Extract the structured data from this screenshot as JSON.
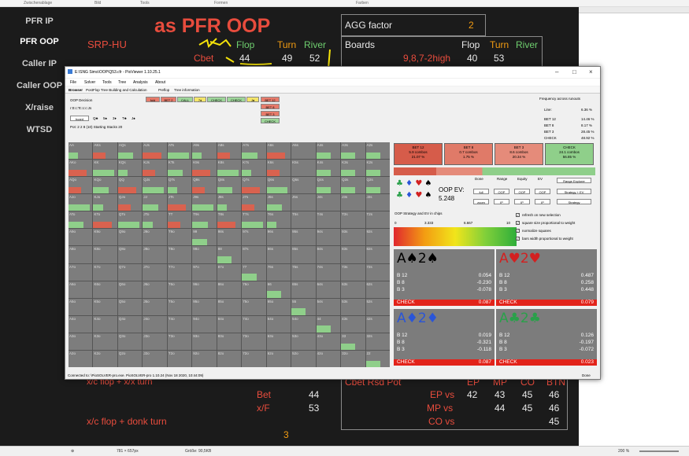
{
  "host": {
    "ribbon": [
      "Zwischenablage",
      "Bild",
      "Tools",
      "Formen",
      "Farben"
    ],
    "status": {
      "size": "781 × 657px",
      "filesize": "Größe: 90,5KB",
      "zoom": "200 %"
    }
  },
  "slide": {
    "sidebar": [
      "PFR IP",
      "PFR OOP",
      "Caller IP",
      "Caller OOP",
      "X/raise",
      "WTSD"
    ],
    "title": "as PFR OOP",
    "srp": "SRP-HU",
    "flop": "Flop",
    "turn": "Turn",
    "river": "River",
    "cbet": "Cbet",
    "cbet_vals": [
      "44",
      "49",
      "52"
    ],
    "agg_factor_label": "AGG factor",
    "agg_factor_value": "2",
    "boards_label": "Boards",
    "boards_value": "9,8,7-2high",
    "boards_vals": [
      "40",
      "53"
    ],
    "xc_label": "x/c flop + x/x turn",
    "bet_label": "Bet",
    "xf_label": "x/F",
    "bet_val": "44",
    "xf_val": "53",
    "donk_label": "x/c flop + donk turn",
    "donk_val": "3",
    "cbet_rsd": "Cbet Rsd Pot",
    "pos_headers": [
      "EP",
      "MP",
      "CO",
      "BTN"
    ],
    "ep_vs": {
      "label": "EP vs",
      "vals": [
        "42",
        "43",
        "45",
        "46"
      ]
    },
    "mp_vs": {
      "label": "MP vs",
      "vals": [
        "44",
        "45",
        "46"
      ]
    },
    "co_vs": {
      "label": "CO vs",
      "vals": [
        "45"
      ]
    }
  },
  "pio": {
    "title": "E:\\SNG Sims\\OOP\\Q53.cfr - PioViewer 1.10.25.1",
    "menu": [
      "File",
      "Solver",
      "Tools",
      "Tree",
      "Analysis",
      "About"
    ],
    "tabs": [
      "Browser",
      "PostFlop Tree Building and Calculation",
      "Preflop",
      "Tree information"
    ],
    "decision": "OOP Decision",
    "line": "r:0:c:Tc:c:c:Js",
    "board_btn": "board",
    "board_cards": [
      "Q♣",
      "5♠",
      "3♦",
      "T♣",
      "J♠"
    ],
    "pot_info": "Pot: 2 2 8 (10) Starting Stacks 20",
    "action_btns": [
      "fold",
      "BET 2",
      "CALL",
      "7♦",
      "CHECK",
      "CHECK",
      "J♠",
      "BET 12"
    ],
    "sub_actions": [
      "BET 8",
      "BET 3",
      "CHECK"
    ],
    "freq_title": "Frequency across runouts",
    "freq_rows": [
      [
        "Line:",
        "6.36 %"
      ],
      [
        "BET 12",
        "14.46 %"
      ],
      [
        "BET 8",
        "8.17 %"
      ],
      [
        "BET 3",
        "28.45 %"
      ],
      [
        "CHECK",
        "48.92 %"
      ]
    ],
    "strategy": [
      {
        "name": "BET 12",
        "combos": "5.9 combos",
        "pct": "21.07 %",
        "color": "#d65c4a"
      },
      {
        "name": "BET 8",
        "combos": "0.7 combos",
        "pct": "1.75 %",
        "color": "#e07a68"
      },
      {
        "name": "BET 3",
        "combos": "8.6 combos",
        "pct": "20.34 %",
        "color": "#e58b7a"
      },
      {
        "name": "CHECK",
        "combos": "24.1 combos",
        "pct": "56.85 %",
        "color": "#8fcf8a"
      }
    ],
    "view_labels": [
      "Done",
      "Range",
      "Equity",
      "EV"
    ],
    "view_btns_row1": [
      "full",
      "OOP",
      "OOP",
      "OOP"
    ],
    "view_btns_row2": [
      "zoom",
      "IP",
      "IP",
      "IP"
    ],
    "range_explorer": "Range Explorer",
    "strategy_ev": "Strategy + EV",
    "strategy_btn": "Strategy",
    "oop_ev_label": "OOP EV:",
    "oop_ev_value": "5.248",
    "strat_ev_caption": "OOP Strategy and EV in chips",
    "scale": [
      "0",
      "3.333",
      "6.667",
      "10"
    ],
    "checkboxes": [
      "refresh on new selection",
      "square size proportional to weight",
      "normalize squares",
      "bars width proportional to weight"
    ],
    "grid": [
      [
        "AA",
        "AKs",
        "AQs",
        "AJs",
        "ATs",
        "A9s",
        "A8s",
        "A7s",
        "A6s",
        "A5s",
        "A4s",
        "A3s",
        "A2s"
      ],
      [
        "AKo",
        "KK",
        "KQs",
        "KJs",
        "KTs",
        "K9s",
        "K8s",
        "K7s",
        "K6s",
        "K5s",
        "K4s",
        "K3s",
        "K2s"
      ],
      [
        "AQo",
        "KQo",
        "QQ",
        "QJs",
        "QTs",
        "Q9s",
        "Q8s",
        "Q7s",
        "Q6s",
        "Q5s",
        "Q4s",
        "Q3s",
        "Q2s"
      ],
      [
        "AJo",
        "KJo",
        "QJo",
        "JJ",
        "JTs",
        "J9s",
        "J8s",
        "J7s",
        "J6s",
        "J5s",
        "J4s",
        "J3s",
        "J2s"
      ],
      [
        "ATo",
        "KTo",
        "QTo",
        "JTo",
        "TT",
        "T9s",
        "T8s",
        "T7s",
        "T6s",
        "T5s",
        "T4s",
        "T3s",
        "T2s"
      ],
      [
        "A9o",
        "K9o",
        "Q9o",
        "J9o",
        "T9o",
        "99",
        "98s",
        "97s",
        "96s",
        "95s",
        "94s",
        "93s",
        "92s"
      ],
      [
        "A8o",
        "K8o",
        "Q8o",
        "J8o",
        "T8o",
        "98o",
        "88",
        "87s",
        "86s",
        "85s",
        "84s",
        "83s",
        "82s"
      ],
      [
        "A7o",
        "K7o",
        "Q7o",
        "J7o",
        "T7o",
        "97o",
        "87o",
        "77",
        "76s",
        "75s",
        "74s",
        "73s",
        "72s"
      ],
      [
        "A6o",
        "K6o",
        "Q6o",
        "J6o",
        "T6o",
        "96o",
        "86o",
        "76o",
        "66",
        "65s",
        "64s",
        "63s",
        "62s"
      ],
      [
        "A5o",
        "K5o",
        "Q5o",
        "J5o",
        "T5o",
        "95o",
        "85o",
        "75o",
        "65o",
        "55",
        "54s",
        "53s",
        "52s"
      ],
      [
        "A4o",
        "K4o",
        "Q4o",
        "J4o",
        "T4o",
        "94o",
        "84o",
        "74o",
        "64o",
        "54o",
        "44",
        "43s",
        "42s"
      ],
      [
        "A3o",
        "K3o",
        "Q3o",
        "J3o",
        "T3o",
        "93o",
        "83o",
        "73o",
        "63o",
        "53o",
        "43o",
        "33",
        "32s"
      ],
      [
        "A2o",
        "K2o",
        "Q2o",
        "J2o",
        "T2o",
        "92o",
        "82o",
        "72o",
        "62o",
        "52o",
        "42o",
        "32o",
        "22"
      ]
    ],
    "combos": [
      {
        "cards": "A♠2♠",
        "color": "#000000",
        "rows": [
          [
            "B 12",
            "0.054"
          ],
          [
            "B 8",
            "-0.230"
          ],
          [
            "B 3",
            "-0.078"
          ]
        ],
        "check": "CHECK",
        "check_val": "0.087"
      },
      {
        "cards": "A♥2♥",
        "color": "#d22020",
        "rows": [
          [
            "B 12",
            "0.487"
          ],
          [
            "B 8",
            "0.258"
          ],
          [
            "B 3",
            "0.448"
          ]
        ],
        "check": "CHECK",
        "check_val": "0.079"
      },
      {
        "cards": "A♦2♦",
        "color": "#2a55d8",
        "rows": [
          [
            "B 12",
            "0.019"
          ],
          [
            "B 8",
            "-0.321"
          ],
          [
            "B 3",
            "-0.118"
          ]
        ],
        "check": "CHECK",
        "check_val": "0.087"
      },
      {
        "cards": "A♣2♣",
        "color": "#2aa04a",
        "rows": [
          [
            "B 12",
            "0.126"
          ],
          [
            "B 8",
            "-0.197"
          ],
          [
            "B 3",
            "-0.072"
          ]
        ],
        "check": "CHECK",
        "check_val": "0.023"
      }
    ],
    "status": "Connected to: \\PioSOLVER-pro.exe. PioSOLVER-pro 1.10.24 (Nov 18 2020, 10:44:09)",
    "done": "Done"
  }
}
